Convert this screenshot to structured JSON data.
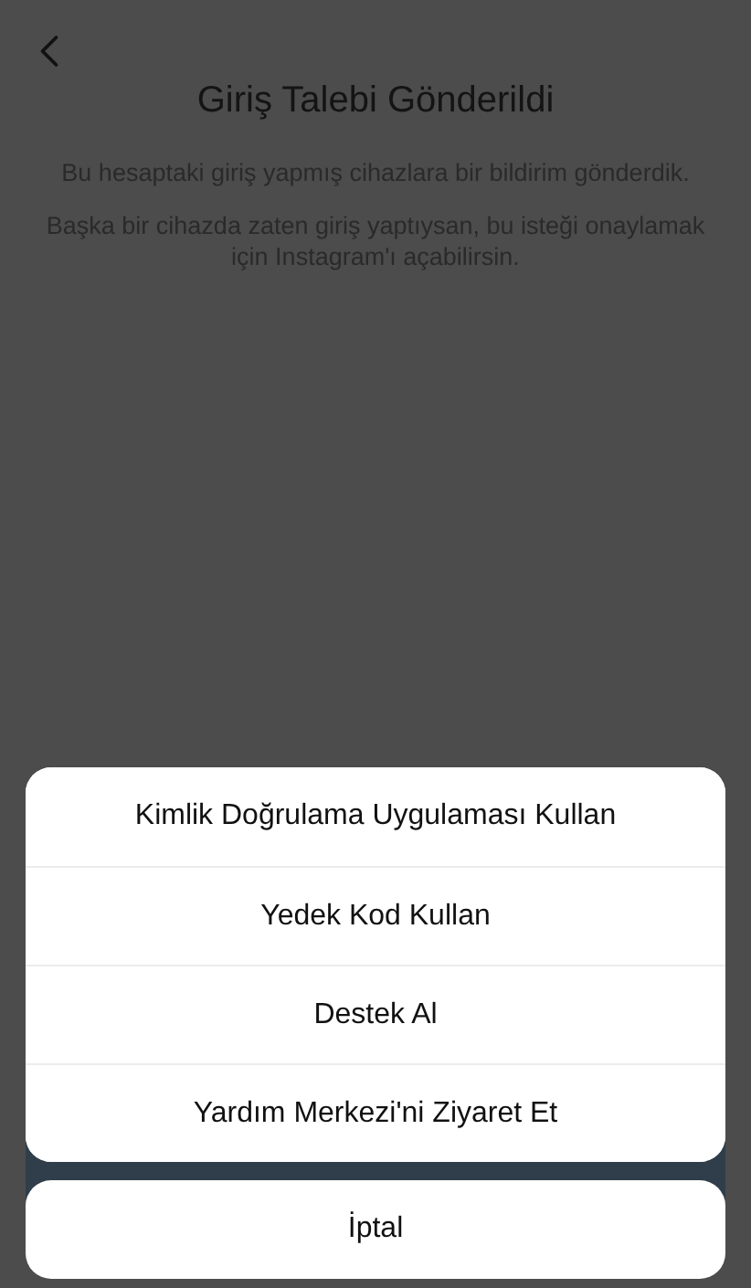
{
  "header": {
    "title": "Giriş Talebi Gönderildi"
  },
  "messages": [
    "Bu hesaptaki giriş yapmış cihazlara bir bildirim gönderdik.",
    "Başka bir cihazda zaten giriş yaptıysan, bu isteği onaylamak için Instagram'ı açabilirsin."
  ],
  "action_sheet": {
    "options": [
      "Kimlik Doğrulama Uygulaması Kullan",
      "Yedek Kod Kullan",
      "Destek Al",
      "Yardım Merkezi'ni Ziyaret Et"
    ],
    "cancel": "İptal"
  }
}
